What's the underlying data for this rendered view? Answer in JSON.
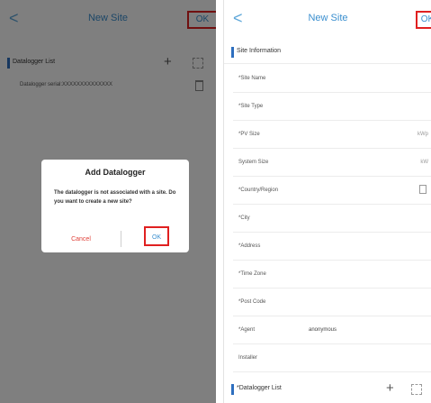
{
  "left_screen": {
    "header": {
      "back": "<",
      "title": "New Site",
      "ok_label": "OK"
    },
    "section": {
      "label": "Datalogger List"
    },
    "datalogger_row": {
      "text": "Datalogger serial:XXXXXXXXXXXXXX"
    },
    "dialog": {
      "title": "Add Datalogger",
      "message": "The datalogger is not associated with a site. Do you want to create a new site?",
      "cancel_label": "Cancel",
      "ok_label": "OK"
    }
  },
  "right_screen": {
    "header": {
      "back": "<",
      "title": "New Site",
      "ok_label": "OK"
    },
    "section": {
      "label": "Site Information"
    },
    "fields": [
      {
        "label": "*Site Name",
        "value": "",
        "unit": ""
      },
      {
        "label": "*Site Type",
        "value": "",
        "unit": ""
      },
      {
        "label": "*PV Size",
        "value": "",
        "unit": "kWp"
      },
      {
        "label": "System Size",
        "value": "",
        "unit": "kW"
      },
      {
        "label": "*Country/Region",
        "value": "",
        "unit": ""
      },
      {
        "label": "*City",
        "value": "",
        "unit": ""
      },
      {
        "label": "*Address",
        "value": "",
        "unit": ""
      },
      {
        "label": "*Time Zone",
        "value": "",
        "unit": ""
      },
      {
        "label": "*Post Code",
        "value": "",
        "unit": ""
      },
      {
        "label": "*Agent",
        "value": "anonymous",
        "unit": ""
      },
      {
        "label": "Installer",
        "value": "",
        "unit": ""
      }
    ],
    "footer_section": {
      "label": "*Datalogger List"
    }
  },
  "colors": {
    "accent": "#3b8fcf",
    "highlight_border": "#e02020",
    "cancel_text": "#e0433b",
    "section_bar": "#2e6fbf"
  }
}
